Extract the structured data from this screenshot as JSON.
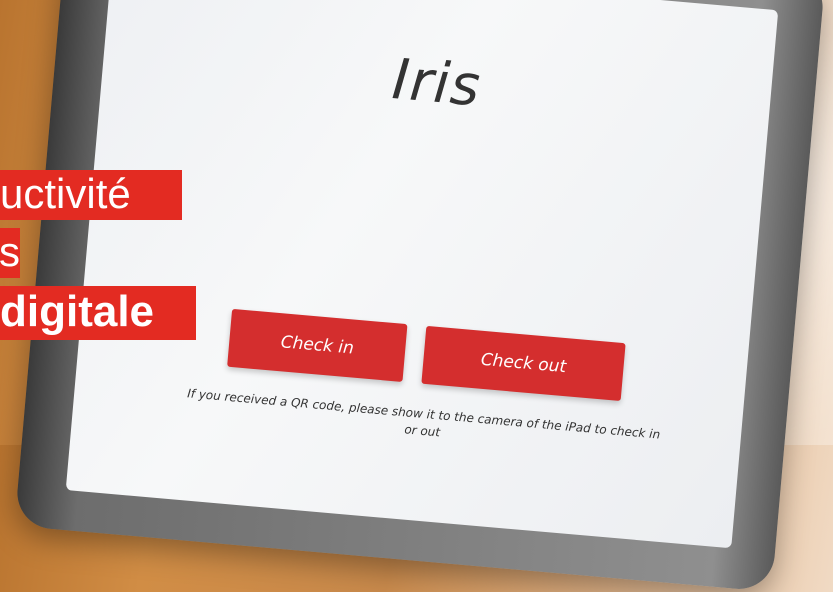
{
  "app": {
    "title": "Iris",
    "check_in_label": "Check in",
    "check_out_label": "Check out",
    "hint_text": "If you received a QR code, please show it to the camera of the iPad to check in or out"
  },
  "overlay": {
    "line1": "uctivité",
    "line2": "s",
    "line3": "digitale"
  },
  "colors": {
    "accent": "#d42e2e",
    "overlay_red": "#e32b22",
    "screen": "#f2f3f5"
  }
}
